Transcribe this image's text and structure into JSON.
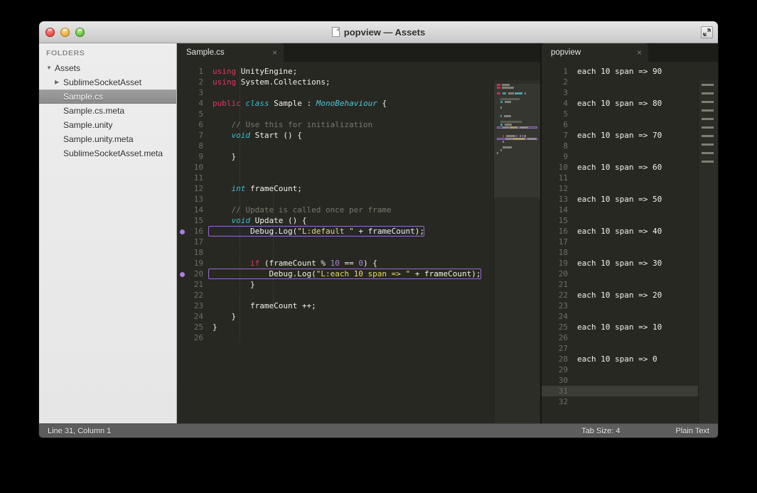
{
  "window": {
    "title": "popview — Assets",
    "doc_icon": "document-icon",
    "resize_icon": "resize-grip-icon",
    "controls": {
      "close": "close-button",
      "minimize": "minimize-button",
      "zoom": "zoom-button"
    }
  },
  "sidebar": {
    "header": "FOLDERS",
    "items": [
      {
        "label": "Assets",
        "indent": 0,
        "arrow": "▼",
        "selected": false
      },
      {
        "label": "SublimeSocketAsset",
        "indent": 1,
        "arrow": "▶",
        "selected": false
      },
      {
        "label": "Sample.cs",
        "indent": 2,
        "arrow": "",
        "selected": true
      },
      {
        "label": "Sample.cs.meta",
        "indent": 2,
        "arrow": "",
        "selected": false
      },
      {
        "label": "Sample.unity",
        "indent": 2,
        "arrow": "",
        "selected": false
      },
      {
        "label": "Sample.unity.meta",
        "indent": 2,
        "arrow": "",
        "selected": false
      },
      {
        "label": "SublimeSocketAsset.meta",
        "indent": 2,
        "arrow": "",
        "selected": false
      }
    ]
  },
  "left_pane": {
    "tab": {
      "label": "Sample.cs",
      "close": "×"
    },
    "total_lines": 26,
    "breakpoint_lines": [
      16,
      20
    ],
    "boxed_lines": [
      16,
      20
    ],
    "lines": [
      {
        "n": 1,
        "tokens": [
          {
            "c": "k",
            "t": "using"
          },
          {
            "c": "fn",
            "t": " UnityEngine;"
          }
        ]
      },
      {
        "n": 2,
        "tokens": [
          {
            "c": "k",
            "t": "using"
          },
          {
            "c": "fn",
            "t": " System.Collections;"
          }
        ]
      },
      {
        "n": 3,
        "tokens": []
      },
      {
        "n": 4,
        "tokens": [
          {
            "c": "k",
            "t": "public"
          },
          {
            "c": "fn",
            "t": " "
          },
          {
            "c": "t",
            "t": "class"
          },
          {
            "c": "fn",
            "t": " Sample : "
          },
          {
            "c": "cn",
            "t": "MonoBehaviour"
          },
          {
            "c": "fn",
            "t": " {"
          }
        ]
      },
      {
        "n": 5,
        "tokens": []
      },
      {
        "n": 6,
        "tokens": [
          {
            "c": "cm",
            "t": "    // Use this for initialization"
          }
        ]
      },
      {
        "n": 7,
        "tokens": [
          {
            "c": "t",
            "t": "    void"
          },
          {
            "c": "fn",
            "t": " Start () {"
          }
        ]
      },
      {
        "n": 8,
        "tokens": []
      },
      {
        "n": 9,
        "tokens": [
          {
            "c": "fn",
            "t": "    }"
          }
        ]
      },
      {
        "n": 10,
        "tokens": []
      },
      {
        "n": 11,
        "tokens": []
      },
      {
        "n": 12,
        "tokens": [
          {
            "c": "t",
            "t": "    int"
          },
          {
            "c": "fn",
            "t": " frameCount;"
          }
        ]
      },
      {
        "n": 13,
        "tokens": []
      },
      {
        "n": 14,
        "tokens": [
          {
            "c": "cm",
            "t": "    // Update is called once per frame"
          }
        ]
      },
      {
        "n": 15,
        "tokens": [
          {
            "c": "t",
            "t": "    void"
          },
          {
            "c": "fn",
            "t": " Update () {"
          }
        ]
      },
      {
        "n": 16,
        "tokens": [
          {
            "c": "fn",
            "t": "        Debug.Log("
          },
          {
            "c": "s",
            "t": "\"L:default \""
          },
          {
            "c": "fn",
            "t": " + frameCount);"
          }
        ]
      },
      {
        "n": 17,
        "tokens": []
      },
      {
        "n": 18,
        "tokens": []
      },
      {
        "n": 19,
        "tokens": [
          {
            "c": "fn",
            "t": "        "
          },
          {
            "c": "k",
            "t": "if"
          },
          {
            "c": "fn",
            "t": " (frameCount % "
          },
          {
            "c": "n",
            "t": "10"
          },
          {
            "c": "fn",
            "t": " == "
          },
          {
            "c": "n",
            "t": "0"
          },
          {
            "c": "fn",
            "t": ") {"
          }
        ]
      },
      {
        "n": 20,
        "tokens": [
          {
            "c": "fn",
            "t": "            Debug.Log("
          },
          {
            "c": "s",
            "t": "\"L:each 10 span => \""
          },
          {
            "c": "fn",
            "t": " + frameCount);"
          }
        ]
      },
      {
        "n": 21,
        "tokens": [
          {
            "c": "fn",
            "t": "        }"
          }
        ]
      },
      {
        "n": 22,
        "tokens": []
      },
      {
        "n": 23,
        "tokens": [
          {
            "c": "fn",
            "t": "        frameCount ++;"
          }
        ]
      },
      {
        "n": 24,
        "tokens": [
          {
            "c": "fn",
            "t": "    }"
          }
        ]
      },
      {
        "n": 25,
        "tokens": [
          {
            "c": "fn",
            "t": "}"
          }
        ]
      },
      {
        "n": 26,
        "tokens": []
      }
    ]
  },
  "right_pane": {
    "tab": {
      "label": "popview",
      "close": "×"
    },
    "total_lines": 32,
    "cursor_line": 31,
    "lines": [
      {
        "n": 1,
        "text": "each 10 span => 90"
      },
      {
        "n": 2,
        "text": ""
      },
      {
        "n": 3,
        "text": ""
      },
      {
        "n": 4,
        "text": "each 10 span => 80"
      },
      {
        "n": 5,
        "text": ""
      },
      {
        "n": 6,
        "text": ""
      },
      {
        "n": 7,
        "text": "each 10 span => 70"
      },
      {
        "n": 8,
        "text": ""
      },
      {
        "n": 9,
        "text": ""
      },
      {
        "n": 10,
        "text": "each 10 span => 60"
      },
      {
        "n": 11,
        "text": ""
      },
      {
        "n": 12,
        "text": ""
      },
      {
        "n": 13,
        "text": "each 10 span => 50"
      },
      {
        "n": 14,
        "text": ""
      },
      {
        "n": 15,
        "text": ""
      },
      {
        "n": 16,
        "text": "each 10 span => 40"
      },
      {
        "n": 17,
        "text": ""
      },
      {
        "n": 18,
        "text": ""
      },
      {
        "n": 19,
        "text": "each 10 span => 30"
      },
      {
        "n": 20,
        "text": ""
      },
      {
        "n": 21,
        "text": ""
      },
      {
        "n": 22,
        "text": "each 10 span => 20"
      },
      {
        "n": 23,
        "text": ""
      },
      {
        "n": 24,
        "text": ""
      },
      {
        "n": 25,
        "text": "each 10 span => 10"
      },
      {
        "n": 26,
        "text": ""
      },
      {
        "n": 27,
        "text": ""
      },
      {
        "n": 28,
        "text": "each 10 span => 0"
      },
      {
        "n": 29,
        "text": ""
      },
      {
        "n": 30,
        "text": ""
      },
      {
        "n": 31,
        "text": ""
      },
      {
        "n": 32,
        "text": ""
      }
    ]
  },
  "statusbar": {
    "position": "Line 31, Column 1",
    "tab_size": "Tab Size: 4",
    "syntax": "Plain Text"
  },
  "colors": {
    "editor_bg": "#272822",
    "keyword": "#e2365f",
    "type": "#38bfd4",
    "string": "#e6db74",
    "number": "#ab7ee0",
    "comment": "#78796a",
    "foreground": "#f2f2ec",
    "breakpoint": "#ab7ee0",
    "highlight_box": "#9a6ad4",
    "selection": "#3b3c35",
    "status_bg": "#5d5d5d"
  }
}
